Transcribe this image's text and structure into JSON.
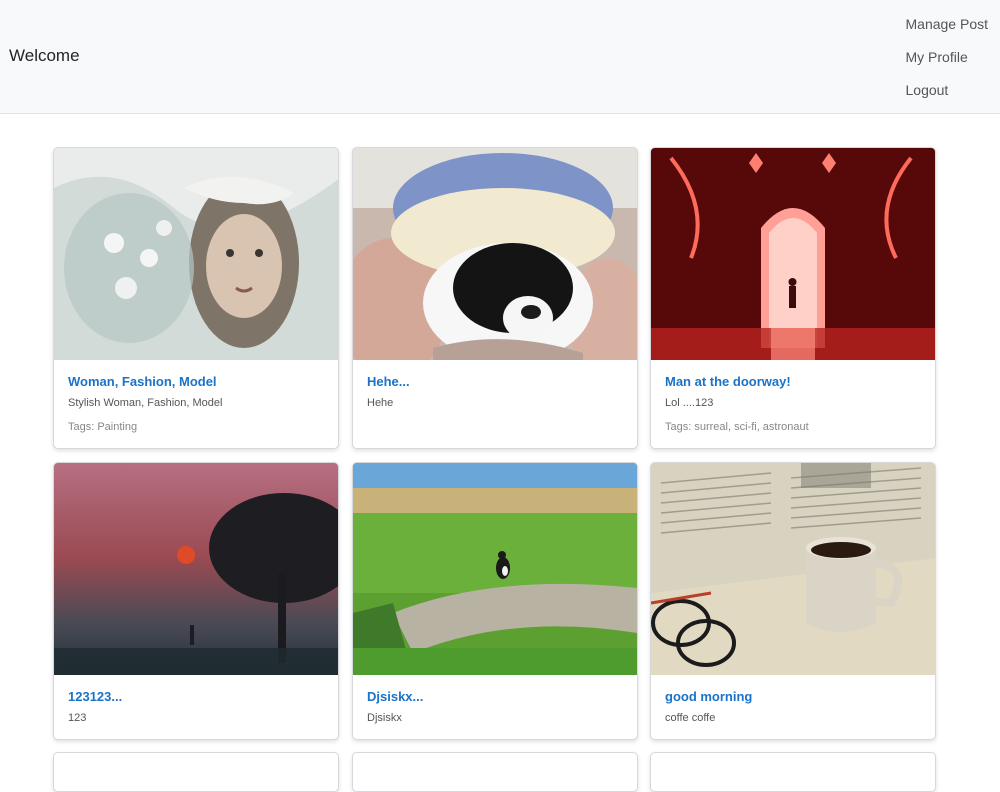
{
  "nav": {
    "brand": "Welcome",
    "links": [
      "Manage Post",
      "My Profile",
      "Logout"
    ]
  },
  "posts": [
    {
      "title": "Woman, Fashion, Model",
      "description": "Stylish Woman, Fashion, Model",
      "tags": "Tags: Painting",
      "image": "sketch-woman-portrait"
    },
    {
      "title": "Hehe...",
      "description": "Hehe",
      "tags": "",
      "image": "cat-in-knit-hat"
    },
    {
      "title": "Man at the doorway!",
      "description": "Lol ....123",
      "tags": "Tags: surreal, sci-fi, astronaut",
      "image": "red-doorway-figure"
    },
    {
      "title": "123123...",
      "description": "123",
      "tags": "",
      "image": "foggy-sunset-tree"
    },
    {
      "title": "Djsiskx...",
      "description": "Djsiskx",
      "tags": "",
      "image": "cat-in-field"
    },
    {
      "title": "good morning",
      "description": "coffe coffe",
      "tags": "",
      "image": "coffee-newspaper"
    }
  ],
  "colors": {
    "link": "#1a73c8",
    "navbar_bg": "#f8f9fa"
  }
}
